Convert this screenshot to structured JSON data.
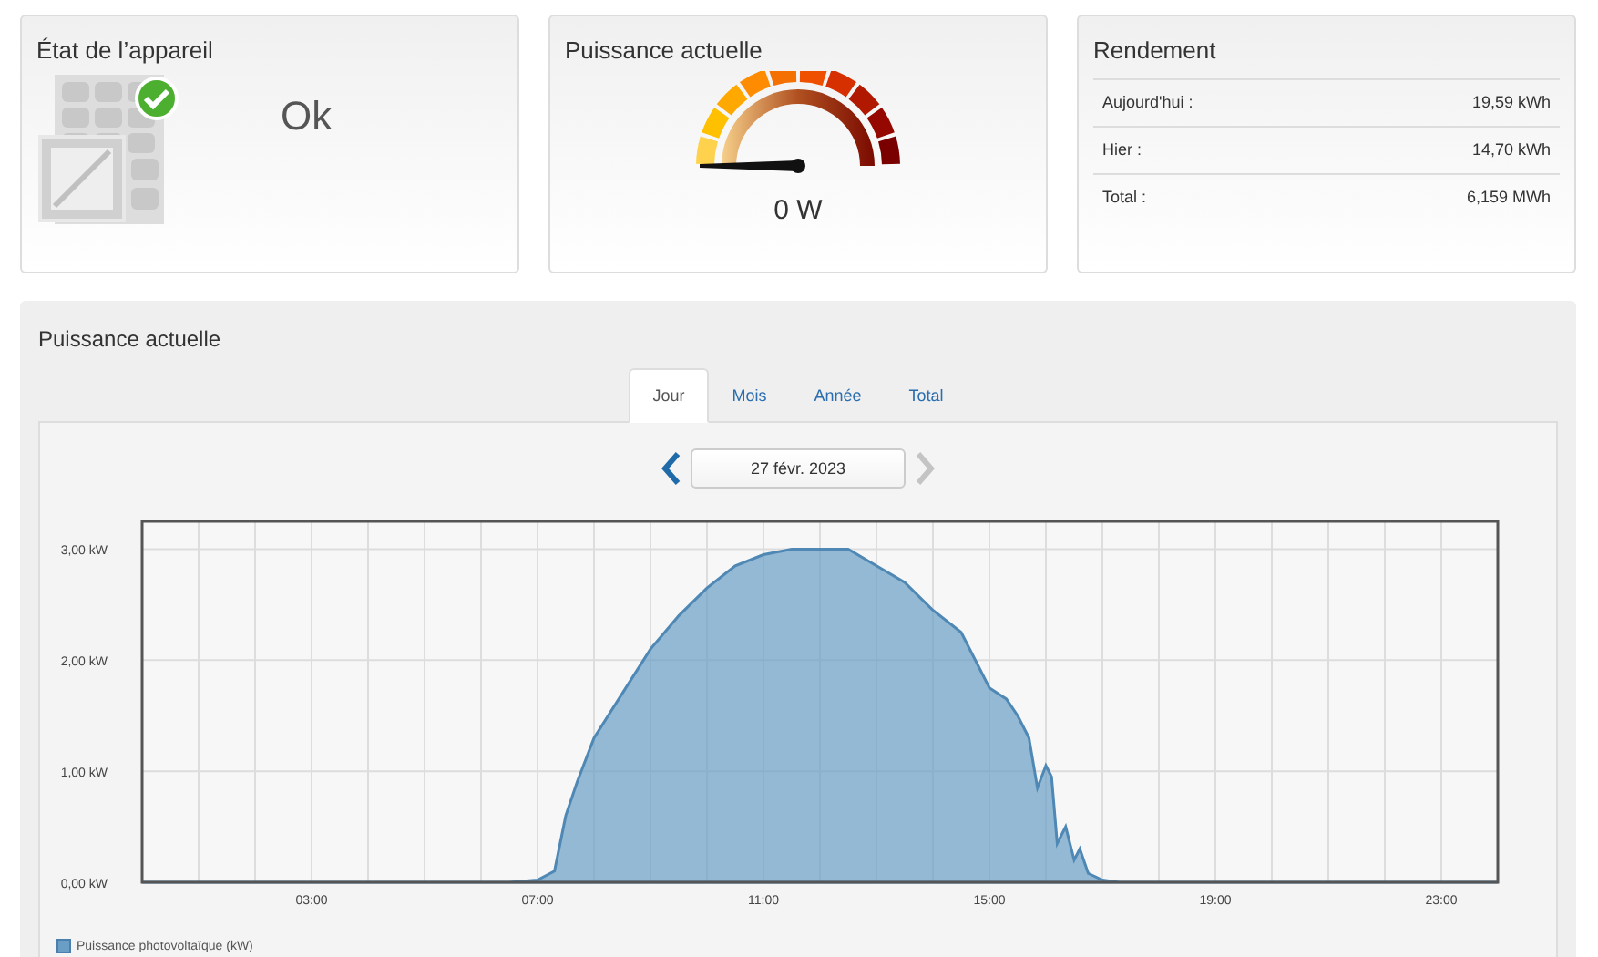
{
  "device_status": {
    "title": "État de l’appareil",
    "status": "Ok"
  },
  "current_power": {
    "title": "Puissance actuelle",
    "reading": "0 W"
  },
  "yield": {
    "title": "Rendement",
    "rows": [
      {
        "label": "Aujourd'hui :",
        "value": "19,59 kWh"
      },
      {
        "label": "Hier :",
        "value": "14,70 kWh"
      },
      {
        "label": "Total :",
        "value": "6,159 MWh"
      }
    ]
  },
  "power_panel": {
    "title": "Puissance actuelle",
    "tabs": [
      {
        "label": "Jour",
        "selected": true
      },
      {
        "label": "Mois",
        "selected": false
      },
      {
        "label": "Année",
        "selected": false
      },
      {
        "label": "Total",
        "selected": false
      }
    ],
    "date_nav": {
      "prev": {
        "disabled": false
      },
      "date": "27 févr. 2023",
      "next": {
        "disabled": true
      }
    },
    "chart_data": {
      "type": "area",
      "x": [
        0,
        1,
        2,
        3,
        4,
        5,
        6,
        6.5,
        7,
        7.3,
        7.5,
        7.7,
        8,
        8.5,
        9,
        9.5,
        10,
        10.5,
        11,
        11.5,
        12,
        12.5,
        13,
        13.5,
        14,
        14.5,
        15,
        15.3,
        15.5,
        15.7,
        15.85,
        16,
        16.1,
        16.2,
        16.35,
        16.5,
        16.6,
        16.75,
        17,
        17.3,
        18,
        19,
        20,
        21,
        22,
        23,
        24
      ],
      "series": [
        {
          "name": "Puissance photovoltaïque (kW)",
          "color": "#6a9ec5",
          "values": [
            0,
            0,
            0,
            0,
            0,
            0,
            0,
            0,
            0.02,
            0.1,
            0.6,
            0.9,
            1.3,
            1.7,
            2.1,
            2.4,
            2.65,
            2.85,
            2.95,
            3.0,
            3.0,
            3.0,
            2.85,
            2.7,
            2.45,
            2.25,
            1.75,
            1.65,
            1.5,
            1.3,
            0.85,
            1.05,
            0.95,
            0.35,
            0.5,
            0.2,
            0.3,
            0.08,
            0.02,
            0,
            0,
            0,
            0,
            0,
            0,
            0,
            0
          ]
        }
      ],
      "xlim": [
        0,
        24
      ],
      "ylim": [
        0,
        3.25
      ],
      "grid": true,
      "xticks": [
        {
          "value": 3,
          "label": "03:00"
        },
        {
          "value": 7,
          "label": "07:00"
        },
        {
          "value": 11,
          "label": "11:00"
        },
        {
          "value": 15,
          "label": "15:00"
        },
        {
          "value": 19,
          "label": "19:00"
        },
        {
          "value": 23,
          "label": "23:00"
        }
      ],
      "yticks": [
        {
          "value": 0,
          "label": "0,00 kW"
        },
        {
          "value": 1,
          "label": "1,00 kW"
        },
        {
          "value": 2,
          "label": "2,00 kW"
        },
        {
          "value": 3,
          "label": "3,00 kW"
        }
      ]
    }
  }
}
